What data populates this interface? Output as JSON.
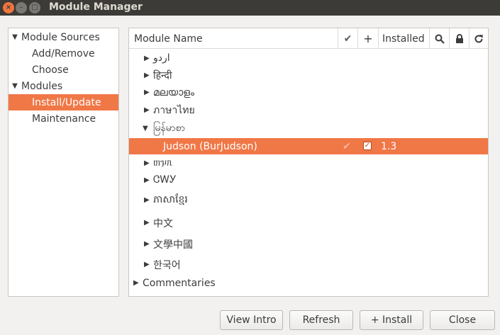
{
  "window": {
    "title": "Module Manager",
    "close_glyph": "×",
    "min_glyph": "–",
    "max_glyph": "□"
  },
  "sidebar": {
    "items": [
      {
        "label": "Module Sources",
        "arrow": "▼"
      },
      {
        "label": "Add/Remove"
      },
      {
        "label": "Choose"
      },
      {
        "label": "Modules",
        "arrow": "▼"
      },
      {
        "label": "Install/Update",
        "selected": true
      },
      {
        "label": "Maintenance"
      }
    ]
  },
  "table": {
    "columns": {
      "name": "Module Name",
      "check": "✔",
      "plus": "+",
      "installed": "Installed",
      "search_icon": "search-icon",
      "lock_icon": "lock-icon",
      "refresh_icon": "refresh-icon"
    },
    "rows": [
      {
        "label": "اردو",
        "arrow": "▶"
      },
      {
        "label": "हिन्दी",
        "arrow": "▶"
      },
      {
        "label": "മലയാളം",
        "arrow": "▶"
      },
      {
        "label": "ภาษาไทย",
        "arrow": "▶"
      },
      {
        "label": "မြန်မာစာ",
        "arrow": "▼"
      },
      {
        "label": "Judson (BurJudson)",
        "check": "✔",
        "checkbox": "✓",
        "installed": "1.3",
        "selected": true
      },
      {
        "label": "ᥖᥭᥰ",
        "arrow": "▶"
      },
      {
        "label": "ᏣᎳᎩ",
        "arrow": "▶"
      },
      {
        "label": "ភាសាខ្មែរ",
        "arrow": "▶"
      },
      {
        "label": "中文",
        "arrow": "▶"
      },
      {
        "label": "文學中國",
        "arrow": "▶"
      },
      {
        "label": "한국어",
        "arrow": "▶"
      },
      {
        "label": "Commentaries",
        "arrow": "▶"
      }
    ]
  },
  "buttons": {
    "view_intro": "View Intro",
    "refresh": "Refresh",
    "install": "+ Install",
    "close": "Close"
  },
  "colors": {
    "accent": "#f07746",
    "titlebar": "#3c3b37"
  }
}
